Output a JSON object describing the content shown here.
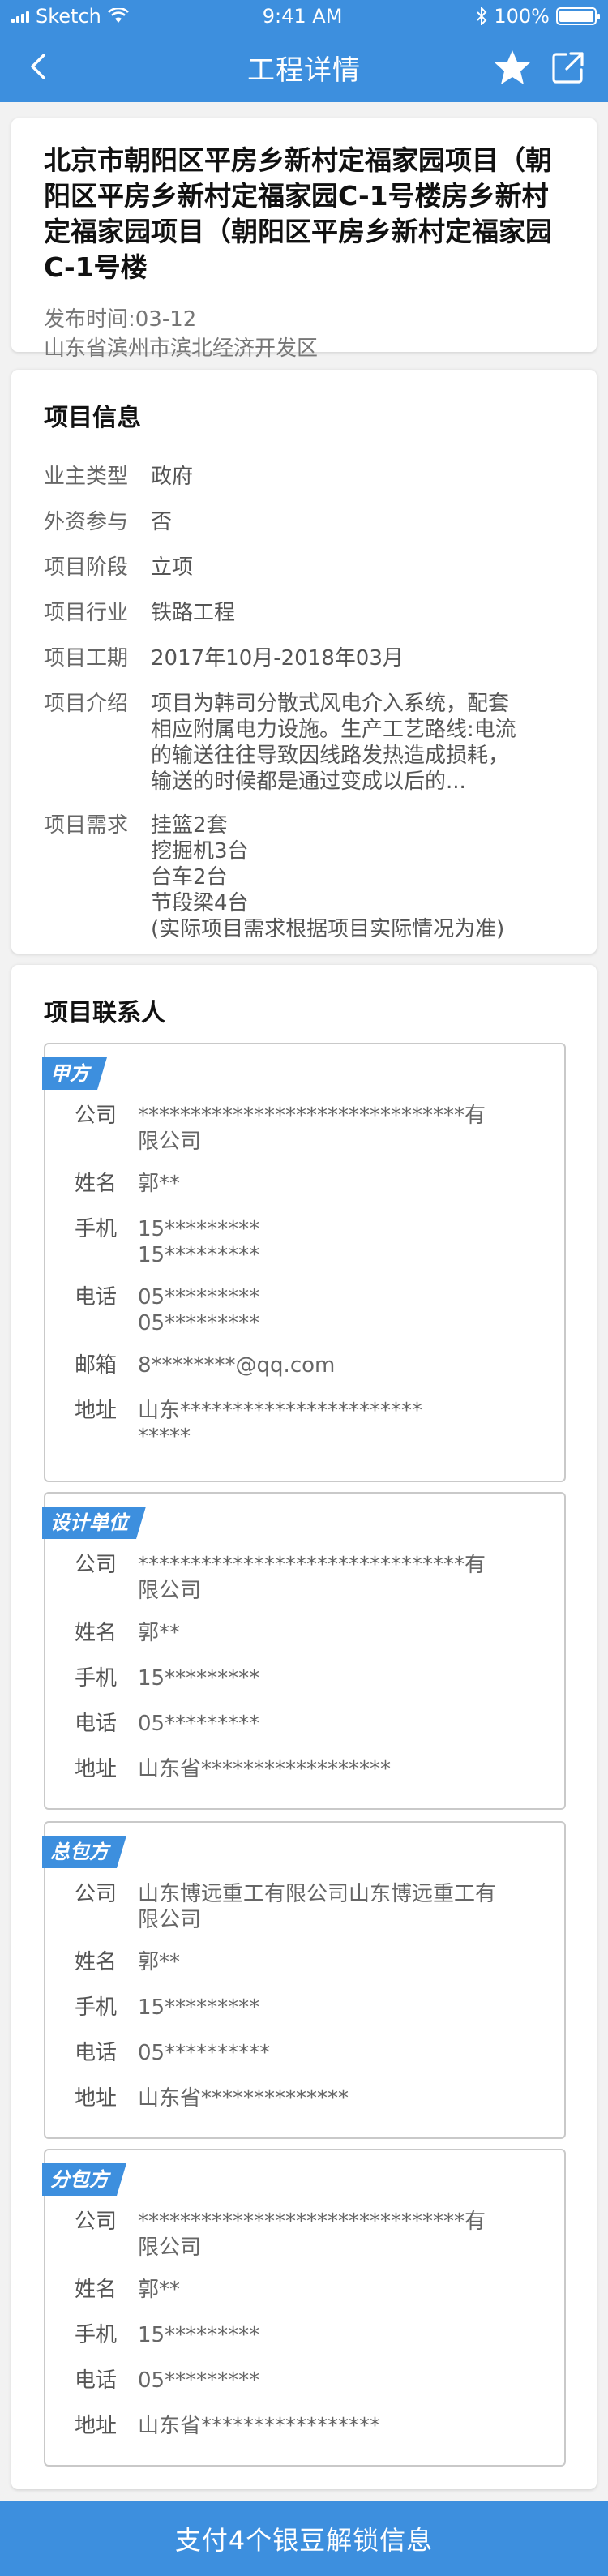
{
  "status_bar": {
    "carrier": "Sketch",
    "time": "9:41 AM",
    "battery": "100%"
  },
  "nav": {
    "title": "工程详情"
  },
  "project": {
    "title": "北京市朝阳区平房乡新村定福家园项目（朝阳区平房乡新村定福家园C-1号楼房乡新村定福家园项目（朝阳区平房乡新村定福家园C-1号楼",
    "publish": "发布时间:03-12",
    "location": "山东省滨州市滨北经济开发区"
  },
  "info": {
    "title": "项目信息",
    "rows": [
      {
        "k": "业主类型",
        "v": "政府"
      },
      {
        "k": "外资参与",
        "v": "否"
      },
      {
        "k": "项目阶段",
        "v": "立项"
      },
      {
        "k": "项目行业",
        "v": "铁路工程"
      },
      {
        "k": "项目工期",
        "v": "2017年10月-2018年03月"
      },
      {
        "k": "项目介绍",
        "lines": [
          "项目为韩司分散式风电介入系统，配套",
          "相应附属电力设施。生产工艺路线:电流",
          "的输送往往导致因线路发热造成损耗，",
          "输送的时候都是通过变成以后的..."
        ]
      },
      {
        "k": "项目需求",
        "lines": [
          "挂篮2套",
          "挖掘机3台",
          "台车2台",
          "节段梁4台",
          "(实际项目需求根据项目实际情况为准)"
        ]
      }
    ]
  },
  "contacts": {
    "title": "项目联系人",
    "labels": {
      "company": "公司",
      "name": "姓名",
      "mobile": "手机",
      "phone": "电话",
      "email": "邮箱",
      "address": "地址"
    },
    "groups": [
      {
        "tag": "甲方",
        "company": [
          "*******************************有",
          "限公司"
        ],
        "name": "郭**",
        "mobile": [
          "15*********",
          "15*********"
        ],
        "phone": [
          "05*********",
          "05*********"
        ],
        "email": "8********@qq.com",
        "address": [
          "山东***********************",
          "*****"
        ]
      },
      {
        "tag": "设计单位",
        "company": [
          "*******************************有",
          "限公司"
        ],
        "name": "郭**",
        "mobile": "15*********",
        "phone": "05*********",
        "address": "山东省******************"
      },
      {
        "tag": "总包方",
        "company": [
          "山东博远重工有限公司山东博远重工有",
          "限公司"
        ],
        "name": "郭**",
        "mobile": "15*********",
        "phone": "05**********",
        "address": "山东省**************"
      },
      {
        "tag": "分包方",
        "company": [
          "*******************************有",
          "限公司"
        ],
        "name": "郭**",
        "mobile": "15*********",
        "phone": "05*********",
        "address": "山东省*****************"
      }
    ]
  },
  "bottom": {
    "button_label": "支付4个银豆解锁信息"
  },
  "colors": {
    "primary": "#3d8fde",
    "background": "#f2f2f2"
  },
  "icons": [
    "signal-icon",
    "wifi-icon",
    "bluetooth-icon",
    "battery-icon",
    "back-icon",
    "star-icon",
    "share-icon"
  ]
}
